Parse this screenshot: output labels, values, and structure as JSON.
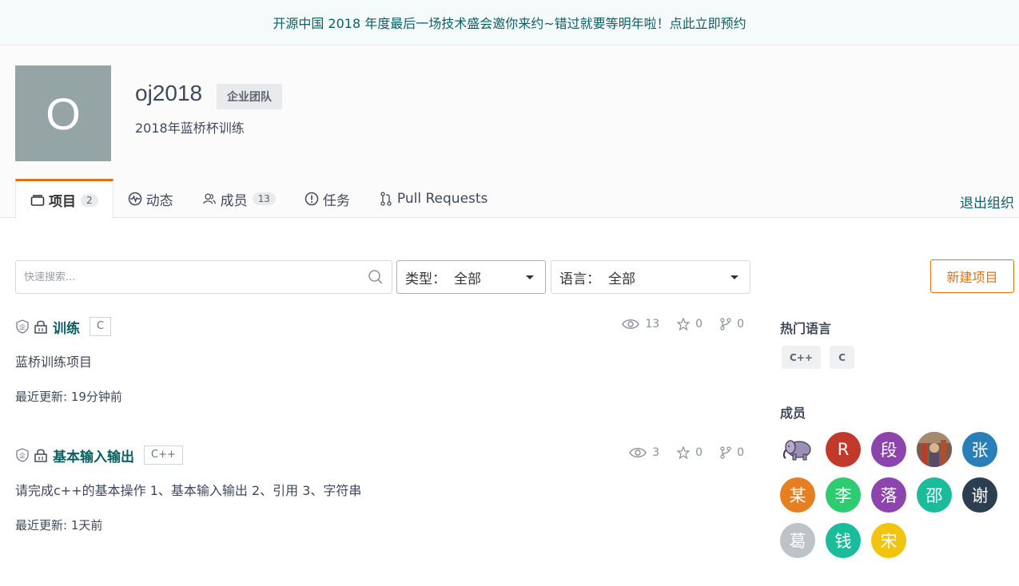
{
  "banner": {
    "text": "开源中国 2018 年度最后一场技术盛会邀你来约~错过就要等明年啦！点此立即预约"
  },
  "org": {
    "avatar_letter": "O",
    "name": "oj2018",
    "badge": "企业团队",
    "description": "2018年蓝桥杯训练"
  },
  "tabs": [
    {
      "label": "项目",
      "count": "2",
      "icon": "repo-icon",
      "active": true
    },
    {
      "label": "动态",
      "icon": "activity-icon"
    },
    {
      "label": "成员",
      "count": "13",
      "icon": "members-icon"
    },
    {
      "label": "任务",
      "icon": "issue-icon"
    },
    {
      "label": "Pull Requests",
      "icon": "pull-request-icon"
    }
  ],
  "exit_label": "退出组织",
  "search": {
    "placeholder": "快速搜索..."
  },
  "filters": {
    "type": {
      "label": "类型：",
      "value": "全部"
    },
    "language": {
      "label": "语言：",
      "value": "全部"
    }
  },
  "new_project_label": "新建项目",
  "projects": [
    {
      "name": "训练",
      "lang": "C",
      "watch": "13",
      "stars": "0",
      "forks": "0",
      "description": "蓝桥训练项目",
      "updated": "最近更新: 19分钟前"
    },
    {
      "name": "基本输入输出",
      "lang": "C++",
      "watch": "3",
      "stars": "0",
      "forks": "0",
      "description": "请完成c++的基本操作 1、基本输入输出 2、引用 3、字符串",
      "updated": "最近更新: 1天前"
    }
  ],
  "sidebar": {
    "hot_languages_title": "热门语言",
    "hot_languages": [
      "C++",
      "C"
    ],
    "members_title": "成员",
    "members": [
      {
        "char": "",
        "icon": "elephant-avatar-icon",
        "color": "#ffffff"
      },
      {
        "char": "R",
        "color": "#c0392b"
      },
      {
        "char": "段",
        "color": "#8e44ad"
      },
      {
        "char": "",
        "icon": "photo-avatar-icon",
        "color": "#8b6a55"
      },
      {
        "char": "张",
        "color": "#2980b9"
      },
      {
        "char": "某",
        "color": "#e67e22"
      },
      {
        "char": "李",
        "color": "#2ecc71"
      },
      {
        "char": "落",
        "color": "#8e44ad"
      },
      {
        "char": "邵",
        "color": "#1abc9c"
      },
      {
        "char": "谢",
        "color": "#2c3e50"
      },
      {
        "char": "葛",
        "color": "#bdc3c7"
      },
      {
        "char": "钱",
        "color": "#1abc9c"
      },
      {
        "char": "宋",
        "color": "#f1c40f"
      }
    ]
  },
  "colors": {
    "accent": "#e4710f",
    "link": "#0b5f63"
  }
}
